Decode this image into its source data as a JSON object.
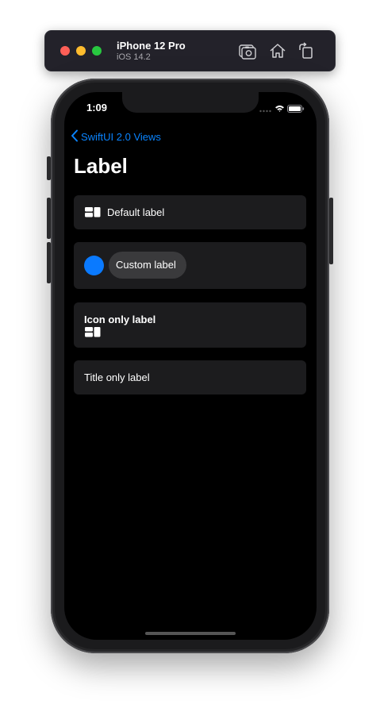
{
  "simulator": {
    "device_name": "iPhone 12 Pro",
    "os_version": "iOS 14.2",
    "icons": [
      "screenshot-icon",
      "home-icon",
      "rotate-icon"
    ]
  },
  "status_bar": {
    "time": "1:09"
  },
  "nav": {
    "back_label": "SwiftUI 2.0 Views",
    "title": "Label"
  },
  "cards": [
    {
      "label": "Default label",
      "icon": "rectangle-grid-icon"
    },
    {
      "label": "Custom label",
      "icon": "blue-circle"
    },
    {
      "label": "Icon only label",
      "icon": "rectangle-grid-icon"
    },
    {
      "label": "Title only label"
    }
  ],
  "colors": {
    "accent": "#0a84ff",
    "screen_background": "#000000",
    "card_background": "#1c1c1e",
    "pill_background": "#3a3a3c",
    "custom_circle": "#0a7aff"
  }
}
